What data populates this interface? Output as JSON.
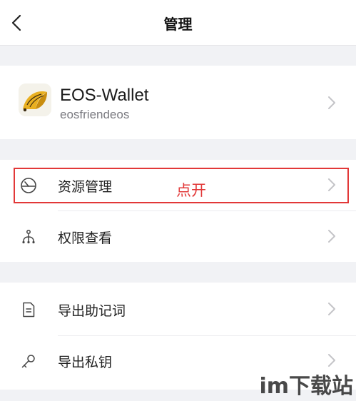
{
  "header": {
    "title": "管理",
    "back_icon": "chevron-left-icon"
  },
  "wallet": {
    "name": "EOS-Wallet",
    "account": "eosfriendeos",
    "logo_icon": "eos-wallet-logo"
  },
  "menu_group_1": [
    {
      "label": "资源管理",
      "icon": "gauge-icon"
    },
    {
      "label": "权限查看",
      "icon": "permission-tree-icon"
    }
  ],
  "menu_group_2": [
    {
      "label": "导出助记词",
      "icon": "document-icon"
    },
    {
      "label": "导出私钥",
      "icon": "key-icon"
    }
  ],
  "annotation": {
    "text": "点开",
    "color": "#e23838"
  },
  "watermark": {
    "text": "im下载站"
  },
  "colors": {
    "background": "#f1f2f5",
    "card": "#ffffff",
    "accent_red": "#e23838",
    "chevron": "#c4c4c8",
    "icon_gray": "#555555"
  }
}
